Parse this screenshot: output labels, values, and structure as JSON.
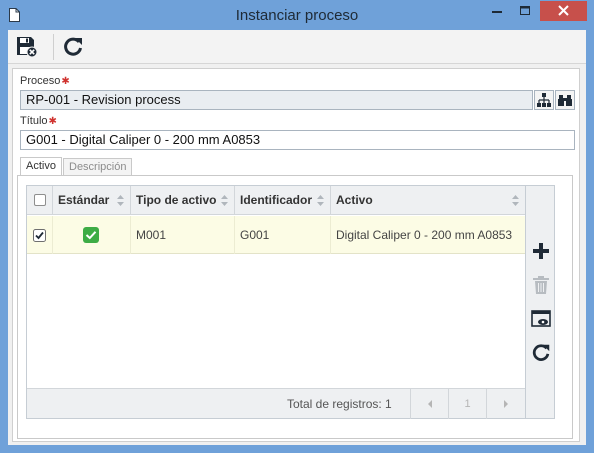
{
  "window": {
    "title": "Instanciar proceso",
    "accent_color": "#6fa1d9",
    "close_color": "#c7504b",
    "icons": [
      "document-icon",
      "minimize-icon",
      "maximize-icon",
      "close-icon"
    ]
  },
  "toolbar": {
    "buttons": [
      {
        "name": "save-and-close-button",
        "icon": "save-close-icon"
      },
      {
        "name": "refresh-button",
        "icon": "refresh-icon"
      }
    ]
  },
  "form": {
    "process_label": "Proceso",
    "process_value": "RP-001 - Revision process",
    "title_label": "Título",
    "title_value": "G001 - Digital Caliper 0 - 200 mm A0853",
    "required_marker": "✱",
    "required_color": "#d0332f"
  },
  "tabs": [
    {
      "label": "Activo",
      "active": true
    },
    {
      "label": "Descripción",
      "active": false
    }
  ],
  "grid": {
    "columns": [
      "Estándar",
      "Tipo de activo",
      "Identificador",
      "Activo"
    ],
    "rows": [
      {
        "selected": true,
        "standard": true,
        "asset_type": "M001",
        "identifier": "G001",
        "asset": "Digital Caliper 0 - 200 mm A0853"
      }
    ],
    "row_highlight_color": "#fcfce5",
    "footer_text": "Total de registros: 1",
    "page": "1"
  },
  "side_actions": [
    {
      "name": "add-button",
      "icon": "plus-icon"
    },
    {
      "name": "delete-button",
      "icon": "trash-icon",
      "disabled": true
    },
    {
      "name": "view-button",
      "icon": "window-eye-icon"
    },
    {
      "name": "refresh-grid-button",
      "icon": "refresh-icon"
    }
  ]
}
